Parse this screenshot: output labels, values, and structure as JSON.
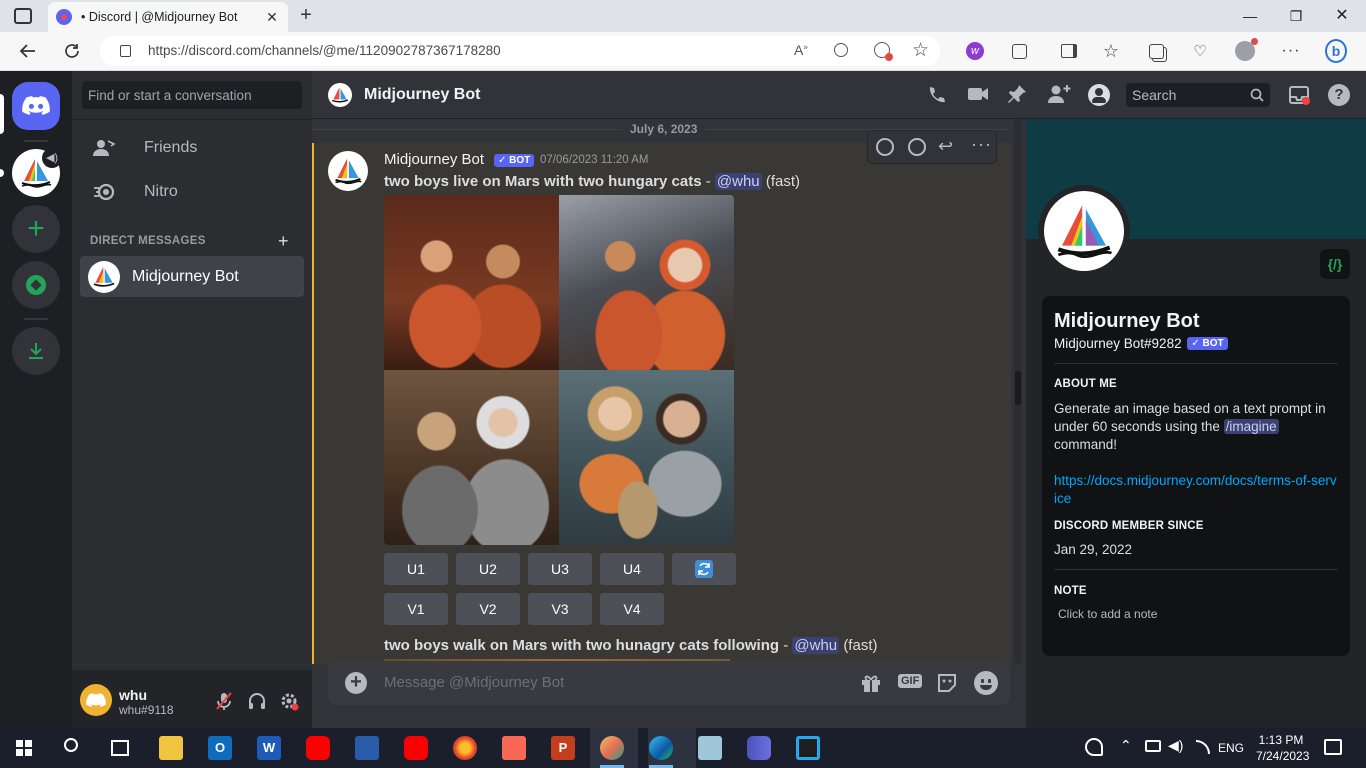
{
  "browser": {
    "tab_title": "• Discord | @Midjourney Bot",
    "url": "https://discord.com/channels/@me/1120902787367178280"
  },
  "dm_column": {
    "search_placeholder": "Find or start a conversation",
    "friends": "Friends",
    "nitro": "Nitro",
    "dm_header": "DIRECT MESSAGES",
    "dm_item": "Midjourney Bot"
  },
  "user_panel": {
    "name": "whu",
    "tag": "whu#9118"
  },
  "chat": {
    "channel_name": "Midjourney Bot",
    "search_placeholder": "Search",
    "date_divider": "July 6, 2023",
    "author": "Midjourney Bot",
    "bot_badge": "✓ BOT",
    "timestamp": "07/06/2023 11:20 AM",
    "message1": {
      "prompt": "two boys live on Mars with two hungary cats",
      "sep": " - ",
      "mention": "@whu",
      "mode": "(fast)"
    },
    "buttons_u": [
      "U1",
      "U2",
      "U3",
      "U4"
    ],
    "buttons_v": [
      "V1",
      "V2",
      "V3",
      "V4"
    ],
    "message2": {
      "prompt": "two boys walk on Mars with two hunagry cats following",
      "sep": " - ",
      "mention": "@whu",
      "mode": "(fast)"
    },
    "composer_placeholder": "Message @Midjourney Bot",
    "gif_label": "GIF"
  },
  "profile": {
    "name": "Midjourney Bot",
    "tag": "Midjourney Bot#9282",
    "bot_badge": "✓ BOT",
    "about_header": "ABOUT ME",
    "about_text_1": "Generate an image based on a text prompt in under 60 seconds using the",
    "about_command": "/imagine",
    "about_text_2": "command!",
    "link": "https://docs.midjourney.com/docs/terms-of-service",
    "member_since_header": "DISCORD MEMBER SINCE",
    "member_since": "Jan 29, 2022",
    "note_header": "NOTE",
    "note_placeholder": "Click to add a note"
  },
  "taskbar": {
    "time": "1:13 PM",
    "date": "7/24/2023",
    "lang": "ENG"
  },
  "colors": {
    "blurple": "#5865f2",
    "mention_bg": "#3c4270",
    "link": "#00a8fc",
    "highlight_border": "#f0b232",
    "green": "#23a559"
  }
}
